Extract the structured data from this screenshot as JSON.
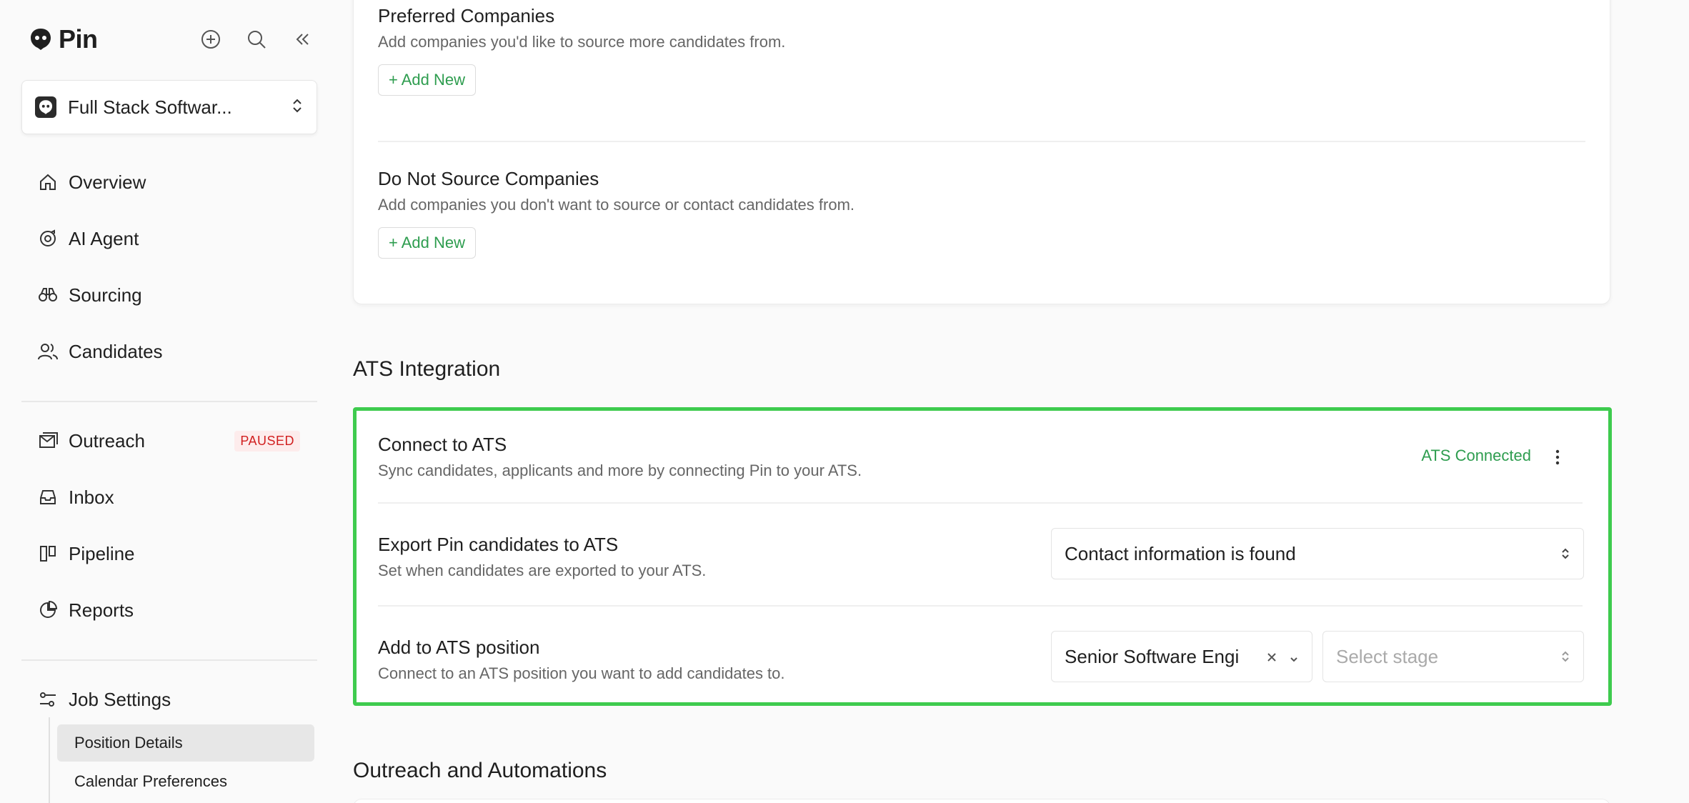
{
  "app": {
    "name": "Pin"
  },
  "project": {
    "title": "Full Stack Softwar..."
  },
  "nav": {
    "overview": "Overview",
    "ai_agent": "AI Agent",
    "sourcing": "Sourcing",
    "candidates": "Candidates",
    "outreach": "Outreach",
    "outreach_badge": "PAUSED",
    "inbox": "Inbox",
    "pipeline": "Pipeline",
    "reports": "Reports",
    "job_settings": "Job Settings",
    "sub": {
      "position_details": "Position Details",
      "calendar_preferences": "Calendar Preferences"
    }
  },
  "companies": {
    "preferred": {
      "title": "Preferred Companies",
      "desc": "Add companies you'd like to source more candidates from.",
      "add_label": "+ Add New"
    },
    "do_not_source": {
      "title": "Do Not Source Companies",
      "desc": "Add companies you don't want to source or contact candidates from.",
      "add_label": "+ Add New"
    }
  },
  "ats": {
    "section_title": "ATS Integration",
    "connect": {
      "title": "Connect to ATS",
      "desc": "Sync candidates, applicants and more by connecting Pin to your ATS.",
      "status": "ATS Connected"
    },
    "export": {
      "title": "Export Pin candidates to ATS",
      "desc": "Set when candidates are exported to your ATS.",
      "selected": "Contact information is found"
    },
    "position": {
      "title": "Add to ATS position",
      "desc": "Connect to an ATS position you want to add candidates to.",
      "selected": "Senior Software Engi",
      "stage_placeholder": "Select stage"
    }
  },
  "outreach_section": {
    "title": "Outreach and Automations"
  },
  "colors": {
    "accent_green": "#2e9d4f",
    "highlight": "#3ecb4e",
    "paused_red": "#d11f1f"
  }
}
